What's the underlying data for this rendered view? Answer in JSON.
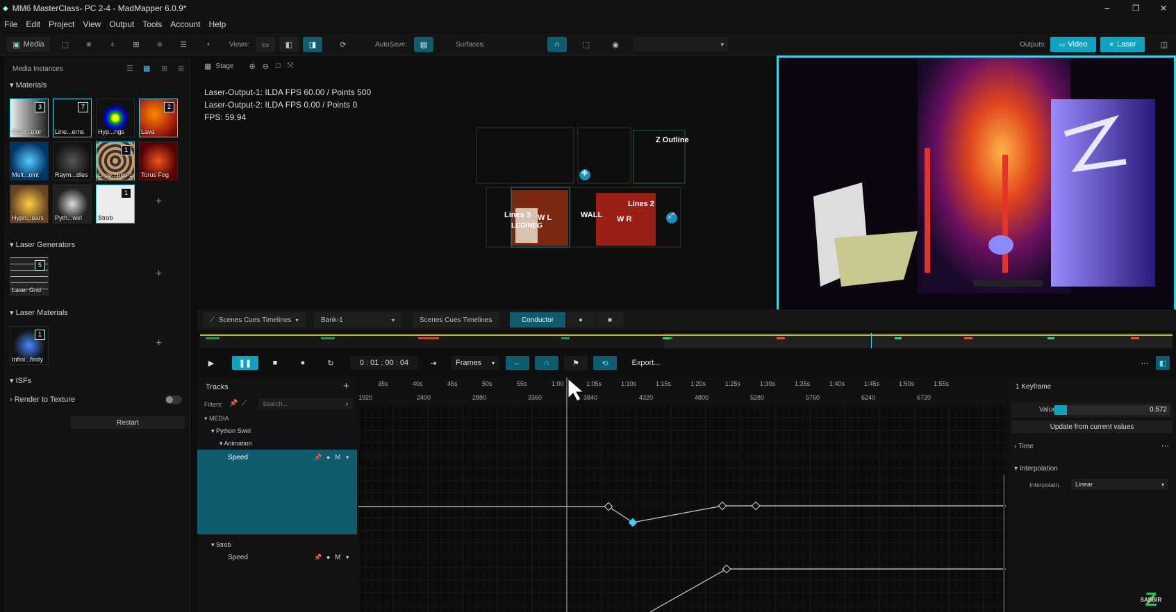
{
  "titlebar": {
    "title": "MM6 MasterClass- PC 2-4 - MadMapper 6.0.9*",
    "minimize": "−",
    "maximize": "❐",
    "close": "✕"
  },
  "menu": [
    "File",
    "Edit",
    "Project",
    "View",
    "Output",
    "Tools",
    "Account",
    "Help"
  ],
  "toolbar": {
    "media_label": "Media",
    "views_label": "Views:",
    "autosave_label": "AutoSave:",
    "surfaces_label": "Surfaces:",
    "outputs_label": "Outputs:",
    "video_label": "Video",
    "laser_label": "Laser",
    "accent": "#0f5c6e"
  },
  "media": {
    "header": "Media Instances",
    "materials_label": "Materials",
    "materials": [
      {
        "name": "Grad...olor",
        "count": "3",
        "color": "#7c8088"
      },
      {
        "name": "Line...erns",
        "count": "7",
        "color": "#2a2a2a"
      },
      {
        "name": "Hyp...ngs",
        "count": "",
        "color": "#3b4e2a"
      },
      {
        "name": "Lava",
        "count": "2",
        "color": "#a4311a"
      },
      {
        "name": "Melt...oint",
        "count": "",
        "color": "#1a6aa0"
      },
      {
        "name": "Raym...dles",
        "count": "",
        "color": "#2c2c2c"
      },
      {
        "name": "Li_re...pes-1",
        "count": "1",
        "color": "#7a5a3a"
      },
      {
        "name": "Torus Fog",
        "count": "",
        "color": "#6a1d10"
      },
      {
        "name": "Hypn...ears",
        "count": "",
        "color": "#8a6620"
      },
      {
        "name": "Pyth...wirl",
        "count": "",
        "color": "#4a4a4a"
      },
      {
        "name": "Strob",
        "count": "1",
        "color": "#e6e6e6"
      }
    ],
    "laser_generators_label": "Laser Generators",
    "laser_generators": [
      {
        "name": "Laser Grid",
        "count": "5"
      }
    ],
    "laser_materials_label": "Laser Materials",
    "laser_materials": [
      {
        "name": "Infini...finity",
        "count": "1"
      }
    ],
    "isfs_label": "ISFs",
    "render_to_texture": "Render to Texture",
    "restart": "Restart"
  },
  "stage": {
    "label": "Stage",
    "info": [
      "Laser-Output-1: ILDA FPS 60.00 / Points 500",
      "Laser-Output-2: ILDA FPS 0.00 / Points 0",
      "FPS: 59.94"
    ],
    "labels": [
      "Z Outline",
      "Lines 3",
      "LCD/NEG",
      "W L",
      "WALL",
      "Lines 2",
      "W R"
    ],
    "handle_1": "✥",
    "handle_2": "⤢"
  },
  "timeline": {
    "tab_1": "Scenes Cues Timelines",
    "bank": "Bank-1",
    "tab_2": "Scenes Cues Timelines",
    "tab_3": "Conductor",
    "timecode": "0 : 01 : 00 : 04",
    "frames": "Frames",
    "export": "Export...",
    "tracks_label": "Tracks",
    "filters_label": "Filters:",
    "search_placeholder": "Search...",
    "time_labels": [
      "35s",
      "40s",
      "45s",
      "50s",
      "55s",
      "1:00",
      "1:05s",
      "1:10s",
      "1:15s",
      "1:20s",
      "1:25s",
      "1:30s",
      "1:35s",
      "1:40s",
      "1:45s",
      "1:50s",
      "1:55s"
    ],
    "frame_labels": [
      "1920",
      "2400",
      "2880",
      "3360",
      "3840",
      "4320",
      "4800",
      "5280",
      "5760",
      "6240",
      "6720"
    ],
    "tree": {
      "media": "MEDIA",
      "python_swirl": "Python Swirl",
      "animation": "Animation",
      "speed": "Speed",
      "strob": "Strob",
      "speed2": "Speed",
      "m": "M"
    }
  },
  "inspector": {
    "title": "1 Keyframe",
    "value_label": "Value",
    "value": "0.572",
    "value_fraction": 0.572,
    "update_btn": "Update from current values",
    "time_label": "Time",
    "interp_label": "Interpolation",
    "interp_field": "Interpolatn.",
    "interp_value": "Linear"
  },
  "watermark": "SABBIR"
}
